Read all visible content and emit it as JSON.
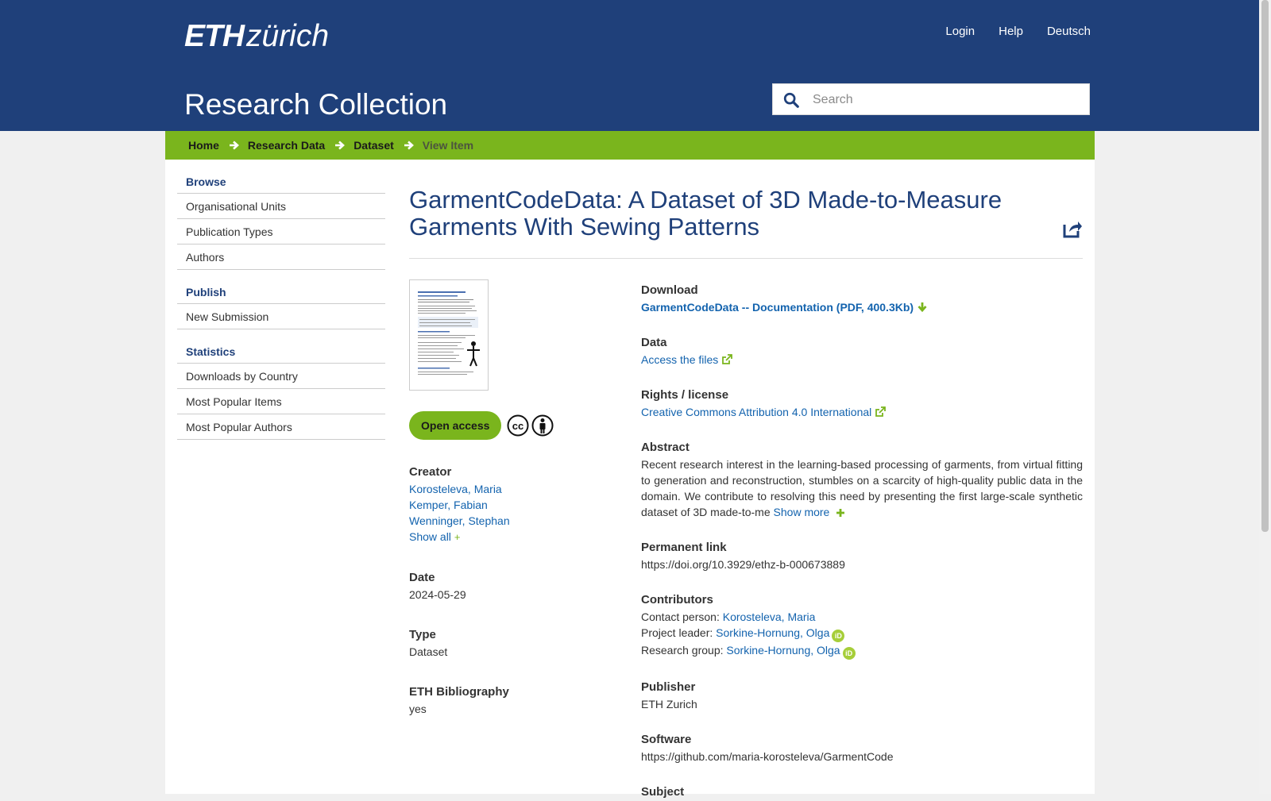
{
  "header": {
    "logo_eth": "ETH",
    "logo_zurich": "zürich",
    "nav": [
      "Login",
      "Help",
      "Deutsch"
    ],
    "site_title": "Research Collection",
    "search_placeholder": "Search"
  },
  "breadcrumb": [
    "Home",
    "Research Data",
    "Dataset",
    "View Item"
  ],
  "sidebar": {
    "browse": {
      "heading": "Browse",
      "items": [
        "Organisational Units",
        "Publication Types",
        "Authors"
      ]
    },
    "publish": {
      "heading": "Publish",
      "items": [
        "New Submission"
      ]
    },
    "statistics": {
      "heading": "Statistics",
      "items": [
        "Downloads by Country",
        "Most Popular Items",
        "Most Popular Authors"
      ]
    }
  },
  "item": {
    "title": "GarmentCodeData: A Dataset of 3D Made-to-Measure Garments With Sewing Patterns",
    "open_access": "Open access",
    "creator": {
      "label": "Creator",
      "names": [
        "Korosteleva, Maria",
        "Kemper, Fabian",
        "Wenninger, Stephan"
      ],
      "show_all": "Show all",
      "plus": "+"
    },
    "date": {
      "label": "Date",
      "value": "2024-05-29"
    },
    "type": {
      "label": "Type",
      "value": "Dataset"
    },
    "bibliography": {
      "label": "ETH Bibliography",
      "value": "yes"
    },
    "download": {
      "label": "Download",
      "link": "GarmentCodeData -- Documentation (PDF, 400.3Kb)"
    },
    "data": {
      "label": "Data",
      "link": "Access the files"
    },
    "rights": {
      "label": "Rights / license",
      "link": "Creative Commons Attribution 4.0 International"
    },
    "abstract": {
      "label": "Abstract",
      "text": "Recent research interest in the learning-based processing of garments, from virtual fitting to generation and reconstruction, stumbles on a scarcity of high-quality public data in the domain. We contribute to resolving this need by presenting the first large-scale synthetic dataset of 3D made-to-me",
      "show_more": "Show more"
    },
    "permanent_link": {
      "label": "Permanent link",
      "value": "https://doi.org/10.3929/ethz-b-000673889"
    },
    "contributors": {
      "label": "Contributors",
      "rows": [
        {
          "role": "Contact person:",
          "name": "Korosteleva, Maria"
        },
        {
          "role": "Project leader:",
          "name": "Sorkine-Hornung, Olga"
        },
        {
          "role": "Research group:",
          "name": "Sorkine-Hornung, Olga"
        }
      ],
      "orcid": "iD"
    },
    "publisher": {
      "label": "Publisher",
      "value": "ETH Zurich"
    },
    "software": {
      "label": "Software",
      "value": "https://github.com/maria-korosteleva/GarmentCode"
    },
    "subject": {
      "label": "Subject"
    }
  }
}
